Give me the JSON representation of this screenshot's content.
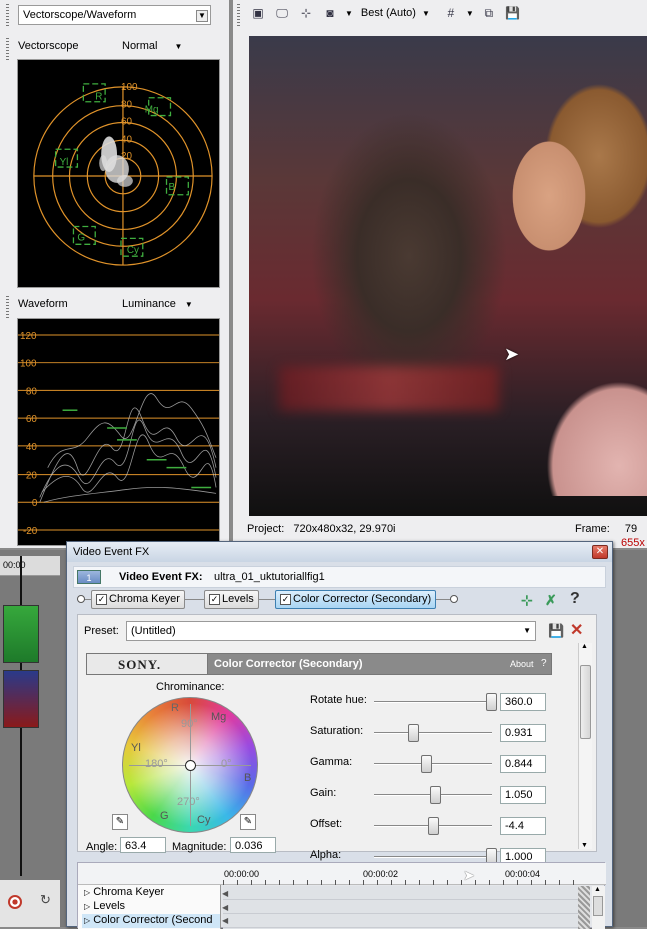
{
  "left_panel": {
    "selector_label": "Vectorscope/Waveform",
    "vectorscope": {
      "title": "Vectorscope",
      "mode": "Normal",
      "ring_labels": [
        "100",
        "80",
        "60",
        "40",
        "20"
      ],
      "targets": [
        "R",
        "Mg",
        "B",
        "Cy",
        "G",
        "Yl"
      ]
    },
    "waveform": {
      "title": "Waveform",
      "mode": "Luminance",
      "axis": [
        "120",
        "100",
        "80",
        "60",
        "40",
        "20",
        "0",
        "-20"
      ]
    }
  },
  "preview": {
    "toolbar": {
      "quality": "Best (Auto)"
    },
    "status": {
      "project_label": "Project:",
      "project_value": "720x480x32, 29.970i",
      "frame_label": "Frame:",
      "frame_value": "79",
      "display_value": "655x"
    }
  },
  "timeline": {
    "time": "00:00"
  },
  "fx_window": {
    "title": "Video Event FX",
    "badge": "1",
    "header_label": "Video Event FX:",
    "header_file": "ultra_01_uktutoriallfig1",
    "chain": [
      {
        "label": "Chroma Keyer",
        "checked": "✓"
      },
      {
        "label": "Levels",
        "checked": "✓"
      },
      {
        "label": "Color Corrector (Secondary)",
        "checked": "✓"
      }
    ],
    "preset_label": "Preset:",
    "preset_value": "(Untitled)",
    "plugin": {
      "brand": "SONY.",
      "name": "Color Corrector (Secondary)",
      "about": "About",
      "help": "?"
    },
    "wheel": {
      "title": "Chrominance:",
      "labels": {
        "r": "R",
        "mg": "Mg",
        "yl": "Yl",
        "b": "B",
        "g": "G",
        "cy": "Cy",
        "d90": "90°",
        "d180": "180°",
        "d0": "0°",
        "d270": "270°"
      },
      "angle_label": "Angle:",
      "angle_value": "63.4",
      "magnitude_label": "Magnitude:",
      "magnitude_value": "0.036"
    },
    "params": [
      {
        "label": "Rotate hue:",
        "value": "360.0",
        "level": 1.0
      },
      {
        "label": "Saturation:",
        "value": "0.931",
        "level": 0.3
      },
      {
        "label": "Gamma:",
        "value": "0.844",
        "level": 0.42
      },
      {
        "label": "Gain:",
        "value": "1.050",
        "level": 0.5
      },
      {
        "label": "Offset:",
        "value": "-4.4",
        "level": 0.48
      },
      {
        "label": "Alpha:",
        "value": "1.000",
        "level": 1.0
      }
    ],
    "keyframes": {
      "times": [
        "00:00:00",
        "00:00:02",
        "00:00:04"
      ],
      "tracks": [
        "Chroma Keyer",
        "Levels",
        "Color Corrector (Second"
      ]
    }
  },
  "colors": {
    "scope_orange": "#e0932a",
    "scope_green": "#3fae3f",
    "window_border": "#54657d",
    "plugin_header": "#8a8a8a",
    "close_red": "#c0392b"
  }
}
